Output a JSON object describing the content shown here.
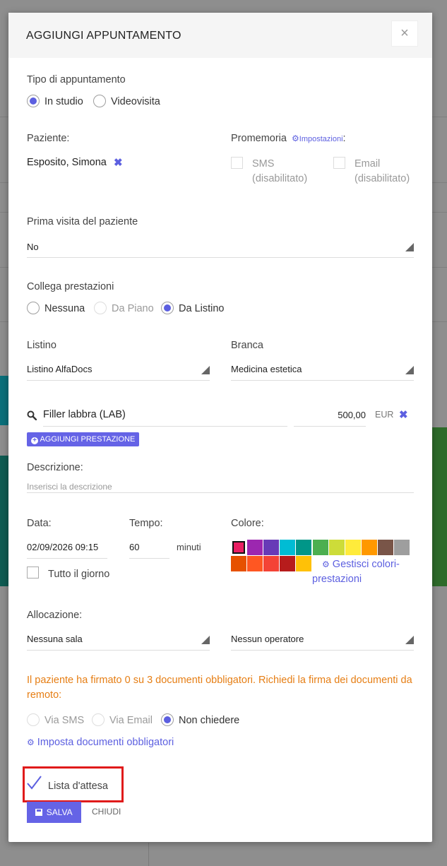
{
  "modal": {
    "title": "AGGIUNGI APPUNTAMENTO",
    "close_label": "×"
  },
  "tipo": {
    "label": "Tipo di appuntamento",
    "options": [
      "In studio",
      "Videovisita"
    ],
    "selected": "In studio"
  },
  "paziente": {
    "label": "Paziente:",
    "value": "Esposito, Simona",
    "remove": "✖"
  },
  "promemoria": {
    "label": "Promemoria",
    "settings_link": "Impostazioni",
    "colon": ":",
    "sms_label": "SMS",
    "sms_state": "(disabilitato)",
    "email_label": "Email",
    "email_state": "(disabilitato)"
  },
  "prima_visita": {
    "label": "Prima visita del paziente",
    "value": "No"
  },
  "collega": {
    "label": "Collega prestazioni",
    "options": [
      "Nessuna",
      "Da Piano",
      "Da Listino"
    ],
    "selected": "Da Listino"
  },
  "listino": {
    "label": "Listino",
    "value": "Listino AlfaDocs"
  },
  "branca": {
    "label": "Branca",
    "value": "Medicina estetica"
  },
  "prestazione": {
    "name": "Filler labbra (LAB)",
    "price": "500,00",
    "currency": "EUR",
    "remove": "✖",
    "add_button": "AGGIUNGI PRESTAZIONE"
  },
  "descrizione": {
    "label": "Descrizione:",
    "placeholder": "Inserisci la descrizione"
  },
  "data": {
    "label": "Data:",
    "value": "02/09/2026 09:15",
    "all_day_label": "Tutto il giorno"
  },
  "tempo": {
    "label": "Tempo:",
    "value": "60",
    "unit": "minuti"
  },
  "colore": {
    "label": "Colore:",
    "row1": [
      "#e91e63",
      "#9c27b0",
      "#673ab7",
      "#00bcd4",
      "#009688",
      "#4caf50",
      "#cddc39",
      "#ffeb3b",
      "#ff9800",
      "#795548",
      "#9e9e9e"
    ],
    "row2": [
      "#e65100",
      "#ff5722",
      "#f44336",
      "#b71c1c",
      "#ffc107"
    ],
    "selected_index": 0,
    "manage_link_1": "Gestisci colori-",
    "manage_link_2": "prestazioni"
  },
  "allocazione": {
    "label": "Allocazione:",
    "sala": "Nessuna sala",
    "operatore": "Nessun operatore"
  },
  "documenti": {
    "warning": "Il paziente ha firmato 0 su 3 documenti obbligatori. Richiedi la firma dei documenti da remoto:",
    "options": [
      "Via SMS",
      "Via Email",
      "Non chiedere"
    ],
    "selected": "Non chiedere",
    "settings_link": "Imposta documenti obbligatori"
  },
  "lista_attesa": {
    "label": "Lista d'attesa",
    "checked": true
  },
  "footer": {
    "save": "SALVA",
    "close": "CHIUDI"
  },
  "colors": {
    "accent": "#6563e6",
    "warning": "#e67e14",
    "highlight": "#e01b1b"
  }
}
